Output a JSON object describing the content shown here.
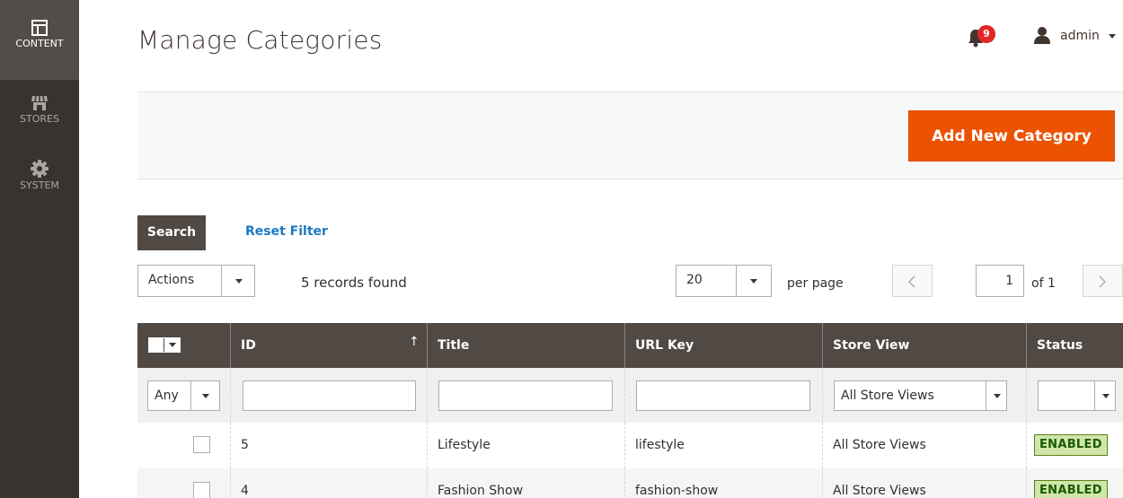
{
  "sidebar": {
    "items": [
      {
        "label": "CONTENT",
        "icon": "content-icon",
        "active": true
      },
      {
        "label": "STORES",
        "icon": "stores-icon",
        "active": false
      },
      {
        "label": "SYSTEM",
        "icon": "system-icon",
        "active": false
      }
    ]
  },
  "header": {
    "title": "Manage Categories",
    "notifications_count": "9",
    "user": "admin"
  },
  "page_actions": {
    "add_label": "Add New Category"
  },
  "search": {
    "search_label": "Search",
    "reset_label": "Reset Filter"
  },
  "toolbar": {
    "actions_label": "Actions",
    "records_found": "5 records found",
    "per_page_value": "20",
    "per_page_label": "per page",
    "current_page": "1",
    "of_label": "of 1"
  },
  "grid": {
    "columns": [
      "ID",
      "Title",
      "URL Key",
      "Store View",
      "Status"
    ],
    "filters": {
      "mass_select": "Any",
      "store_view": "All Store Views"
    },
    "rows": [
      {
        "id": "5",
        "title": "Lifestyle",
        "url_key": "lifestyle",
        "store_view": "All Store Views",
        "status": "ENABLED"
      },
      {
        "id": "4",
        "title": "Fashion Show",
        "url_key": "fashion-show",
        "store_view": "All Store Views",
        "status": "ENABLED"
      }
    ]
  },
  "colors": {
    "sidebar_bg": "#373330",
    "accent_orange": "#eb5202",
    "grid_header": "#514943",
    "link_blue": "#1979c3",
    "badge_green_bg": "#d0e5a9"
  }
}
